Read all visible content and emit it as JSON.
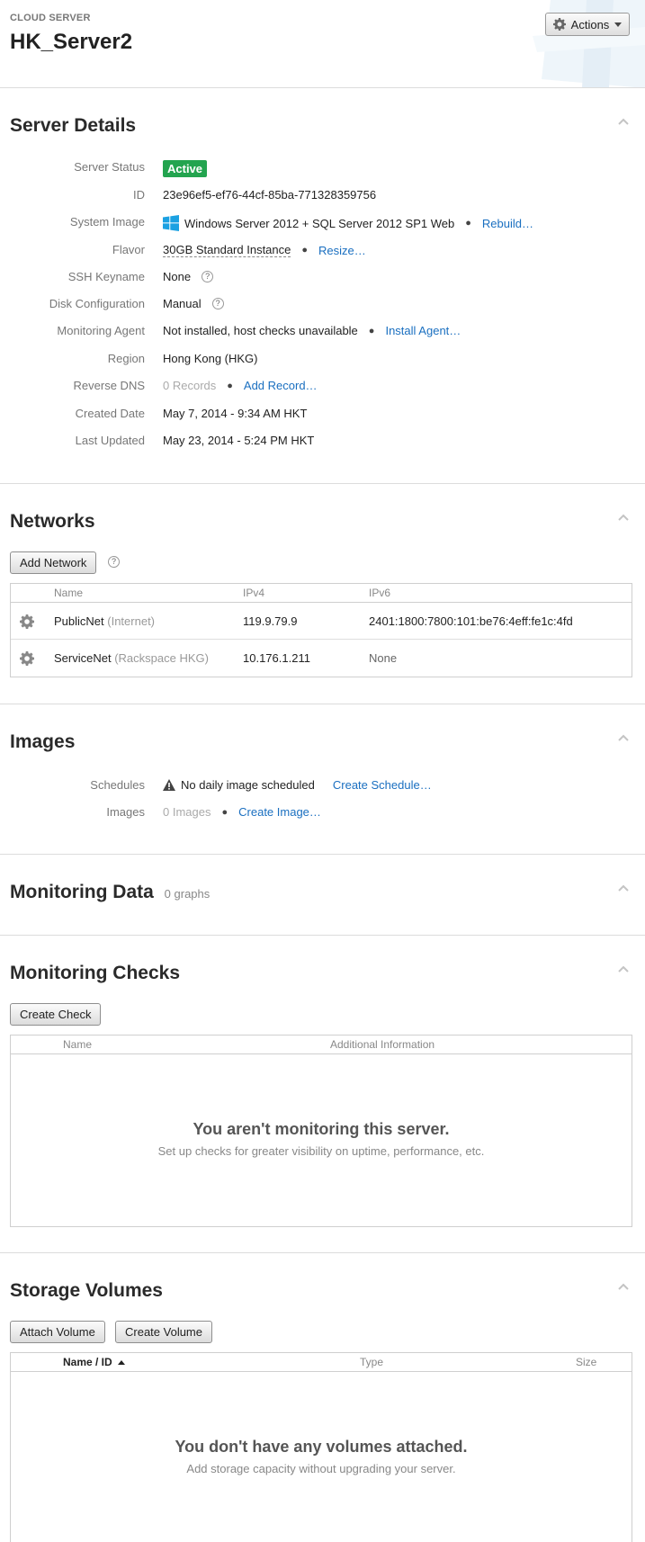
{
  "header": {
    "eyebrow": "CLOUD SERVER",
    "title": "HK_Server2",
    "actions_label": "Actions"
  },
  "server_details": {
    "title": "Server Details",
    "status_label": "Server Status",
    "status_value": "Active",
    "id_label": "ID",
    "id_value": "23e96ef5-ef76-44cf-85ba-771328359756",
    "image_label": "System Image",
    "image_value": "Windows Server 2012 + SQL Server 2012 SP1 Web",
    "image_action": "Rebuild…",
    "flavor_label": "Flavor",
    "flavor_value": "30GB Standard Instance",
    "flavor_action": "Resize…",
    "ssh_label": "SSH Keyname",
    "ssh_value": "None",
    "disk_label": "Disk Configuration",
    "disk_value": "Manual",
    "agent_label": "Monitoring Agent",
    "agent_value": "Not installed, host checks unavailable",
    "agent_action": "Install Agent…",
    "region_label": "Region",
    "region_value": "Hong Kong (HKG)",
    "rdns_label": "Reverse DNS",
    "rdns_value": "0 Records",
    "rdns_action": "Add Record…",
    "created_label": "Created Date",
    "created_value": "May 7, 2014 - 9:34 AM HKT",
    "updated_label": "Last Updated",
    "updated_value": "May 23, 2014 - 5:24 PM HKT"
  },
  "networks": {
    "title": "Networks",
    "add_label": "Add Network",
    "columns": [
      "Name",
      "IPv4",
      "IPv6"
    ],
    "rows": [
      {
        "name": "PublicNet",
        "detail": "(Internet)",
        "ipv4": "119.9.79.9",
        "ipv6": "2401:1800:7800:101:be76:4eff:fe1c:4fd"
      },
      {
        "name": "ServiceNet",
        "detail": "(Rackspace HKG)",
        "ipv4": "10.176.1.211",
        "ipv6": "None"
      }
    ]
  },
  "images": {
    "title": "Images",
    "schedules_label": "Schedules",
    "schedules_value": "No daily image scheduled",
    "schedules_action": "Create Schedule…",
    "images_label": "Images",
    "images_value": "0 Images",
    "images_action": "Create Image…"
  },
  "monitoring_data": {
    "title": "Monitoring Data",
    "count": "0 graphs"
  },
  "monitoring_checks": {
    "title": "Monitoring Checks",
    "create_label": "Create Check",
    "columns": [
      "Name",
      "Additional Information"
    ],
    "empty_title": "You aren't monitoring this server.",
    "empty_sub": "Set up checks for greater visibility on uptime, performance, etc."
  },
  "storage_volumes": {
    "title": "Storage Volumes",
    "attach_label": "Attach Volume",
    "create_label": "Create Volume",
    "columns": [
      "Name / ID",
      "Type",
      "Size"
    ],
    "empty_title": "You don't have any volumes attached.",
    "empty_sub": "Add storage capacity without upgrading your server."
  },
  "colors": {
    "status_active": "#23a44f",
    "link": "#1a6fc0",
    "windows_logo": "#1ba1e2"
  }
}
